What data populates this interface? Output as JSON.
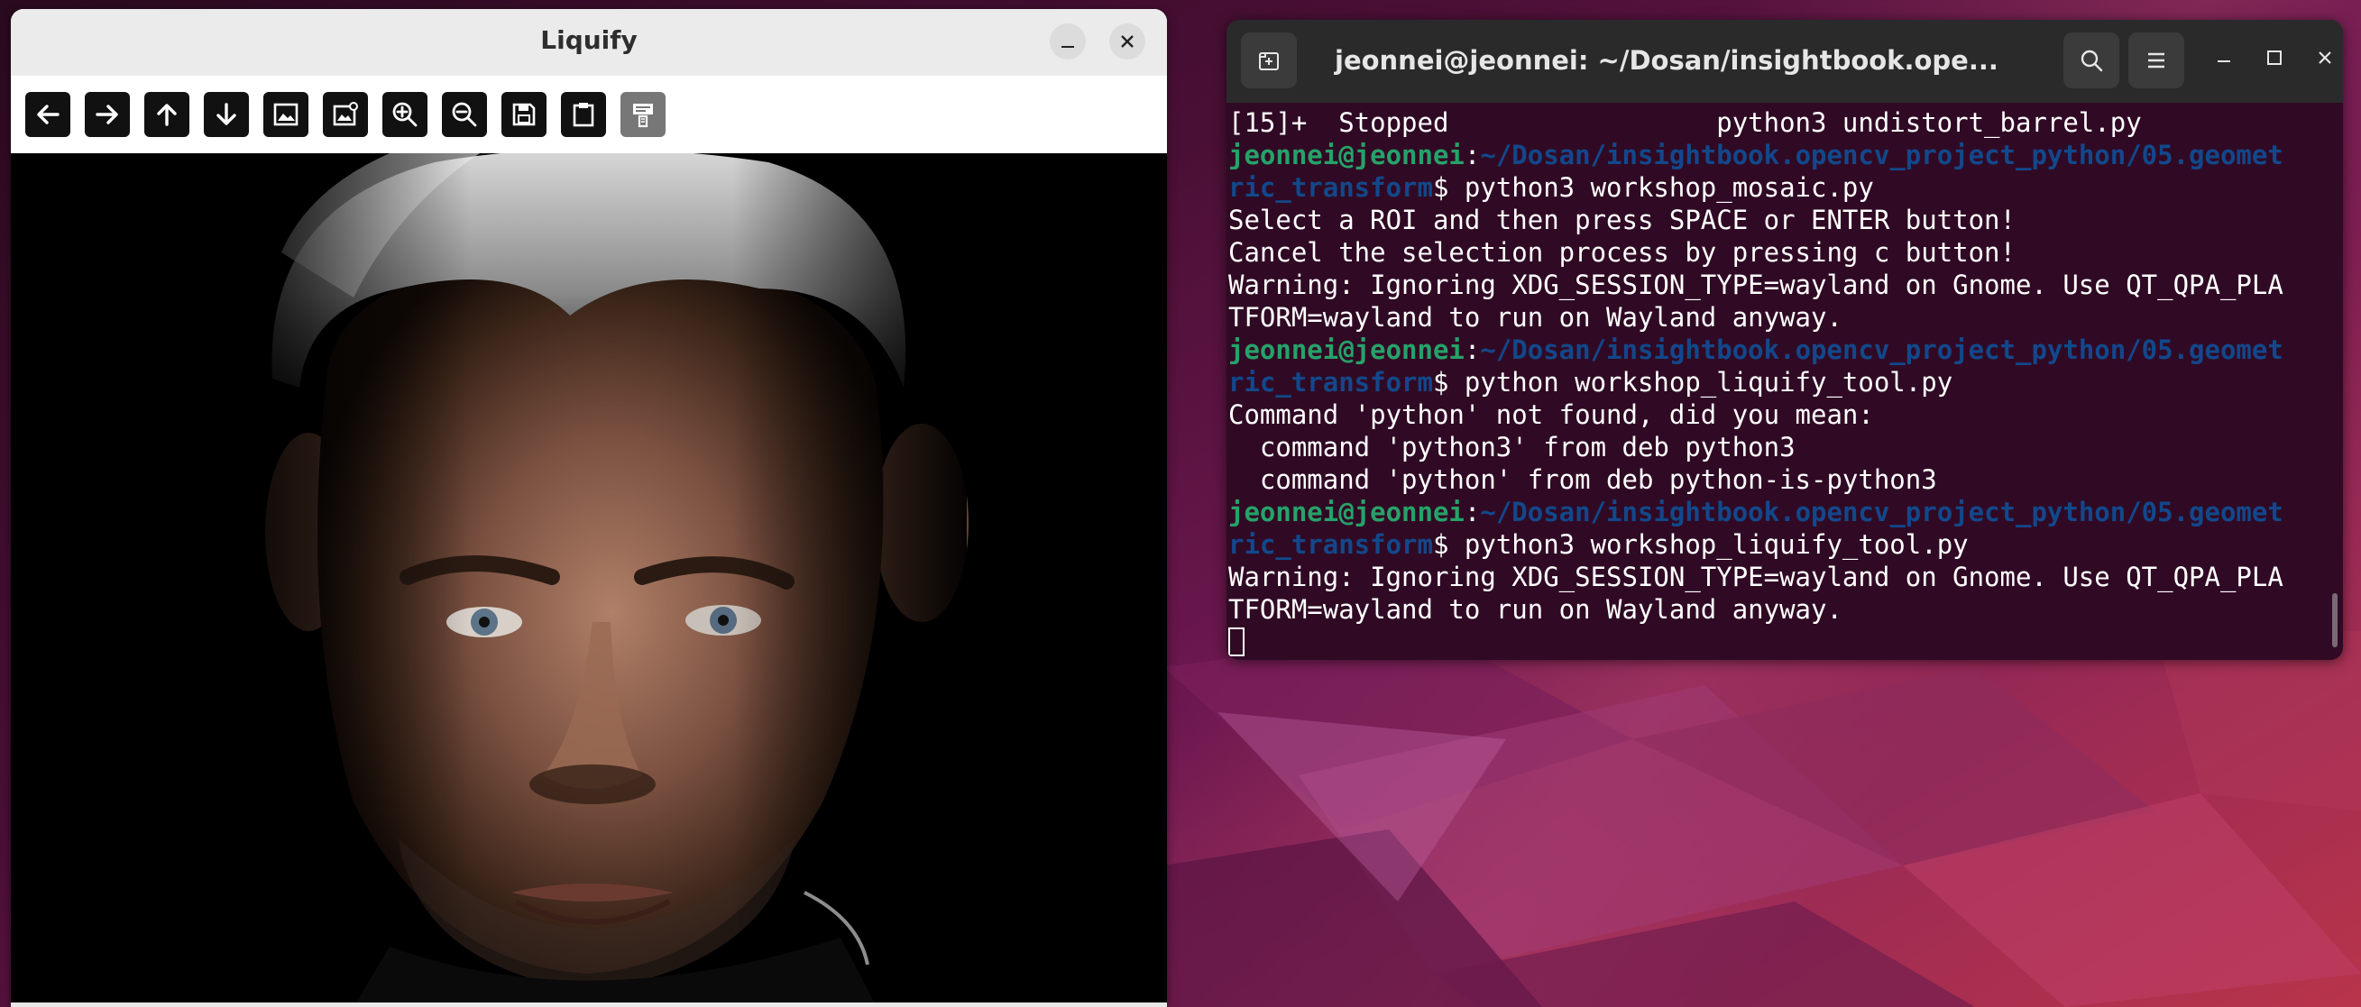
{
  "liquify_window": {
    "title": "Liquify",
    "toolbar_icons": [
      "back-arrow-icon",
      "forward-arrow-icon",
      "up-arrow-icon",
      "down-arrow-icon",
      "image-icon",
      "image-settings-icon",
      "zoom-in-icon",
      "zoom-out-icon",
      "save-icon",
      "clipboard-icon",
      "properties-icon"
    ]
  },
  "terminal_window": {
    "title": "jeonnei@jeonnei: ~/Dosan/insightbook.ope...",
    "lines": [
      {
        "text": "[15]+  Stopped                 python3 undistort_barrel.py"
      },
      {
        "user": "jeonnei@jeonnei",
        "sep": ":",
        "path": "~/Dosan/insightbook.opencv_project_python/05.geomet"
      },
      {
        "path": "ric_transform",
        "rest": "$ python3 workshop_mosaic.py"
      },
      {
        "text": "Select a ROI and then press SPACE or ENTER button!"
      },
      {
        "text": "Cancel the selection process by pressing c button!"
      },
      {
        "text": "Warning: Ignoring XDG_SESSION_TYPE=wayland on Gnome. Use QT_QPA_PLA"
      },
      {
        "text": "TFORM=wayland to run on Wayland anyway."
      },
      {
        "user": "jeonnei@jeonnei",
        "sep": ":",
        "path": "~/Dosan/insightbook.opencv_project_python/05.geomet"
      },
      {
        "path": "ric_transform",
        "rest": "$ python workshop_liquify_tool.py"
      },
      {
        "text": "Command 'python' not found, did you mean:"
      },
      {
        "text": "  command 'python3' from deb python3"
      },
      {
        "text": "  command 'python' from deb python-is-python3"
      },
      {
        "user": "jeonnei@jeonnei",
        "sep": ":",
        "path": "~/Dosan/insightbook.opencv_project_python/05.geomet"
      },
      {
        "path": "ric_transform",
        "rest": "$ python3 workshop_liquify_tool.py"
      },
      {
        "text": "Warning: Ignoring XDG_SESSION_TYPE=wayland on Gnome. Use QT_QPA_PLA"
      },
      {
        "text": "TFORM=wayland to run on Wayland anyway."
      }
    ]
  },
  "colors": {
    "terminal_bg": "#300a24",
    "prompt_user": "#26a269",
    "prompt_path": "#12488b"
  }
}
